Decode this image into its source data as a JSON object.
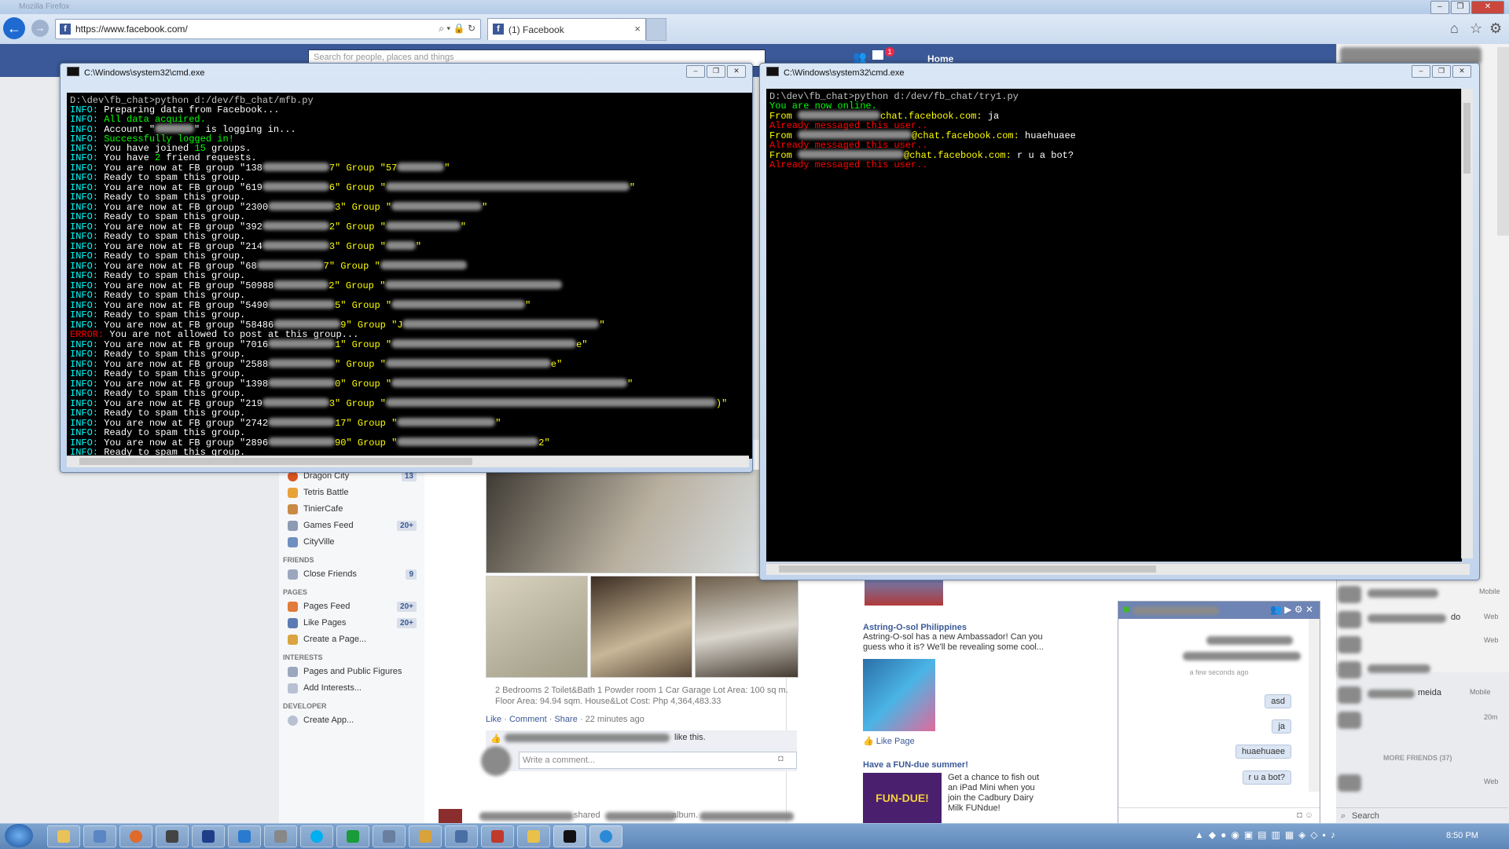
{
  "browser": {
    "url": "https://www.facebook.com/",
    "tab_label": "(1) Facebook",
    "tab_close": "×",
    "faded_title": "Mozilla Firefox"
  },
  "facebook": {
    "search_placeholder": "Search for people, places and things",
    "home_label": "Home",
    "notification_count": "1",
    "sidebar": {
      "apps": [
        {
          "label": "Dragon City",
          "count": "13",
          "color": "#d9531e"
        },
        {
          "label": "Tetris Battle",
          "count": "",
          "color": "#e8a23a"
        },
        {
          "label": "TinierCafe",
          "count": "",
          "color": "#c98a45"
        },
        {
          "label": "Games Feed",
          "count": "20+",
          "color": "#8c9bb3"
        },
        {
          "label": "CityVille",
          "count": "",
          "color": "#6f8fbf"
        }
      ],
      "friends_heading": "FRIENDS",
      "close_friends": {
        "label": "Close Friends",
        "count": "9"
      },
      "pages_heading": "PAGES",
      "pages": [
        {
          "label": "Pages Feed",
          "count": "20+"
        },
        {
          "label": "Like Pages",
          "count": "20+"
        },
        {
          "label": "Create a Page...",
          "count": ""
        }
      ],
      "interests_heading": "INTERESTS",
      "interests": [
        {
          "label": "Pages and Public Figures"
        },
        {
          "label": "Add Interests..."
        }
      ],
      "developer_heading": "DEVELOPER",
      "developer": [
        {
          "label": "Create App..."
        }
      ]
    },
    "post": {
      "caption_line1": "2 Bedrooms 2 Toilet&Bath 1 Powder room 1 Car Garage Lot Area: 100 sq m.",
      "caption_line2": "Floor Area: 94.94 sqm. House&Lot Cost: Php 4,364,483.33",
      "like": "Like",
      "comment": "Comment",
      "share": "Share",
      "time": "22 minutes ago",
      "sep": "·",
      "likes_suffix": "like this.",
      "comment_placeholder": "Write a comment...",
      "shared_text": "shared",
      "album_text": "album."
    },
    "ads": [
      {
        "title": "Astring-O-sol Philippines",
        "desc": "Astring-O-sol has a new Ambassador! Can you guess who it is? We'll be revealing some cool...",
        "cta": "Like Page"
      },
      {
        "title": "Have a FUN-due summer!",
        "desc": "Get a chance to fish out an iPad Mini when you join the Cadbury Dairy Milk FUNdue!",
        "image_text": "FUN-DUE!"
      }
    ],
    "chat": {
      "timestamp": "a few seconds ago",
      "messages": [
        "asd",
        "ja",
        "huaehuaee",
        "r u a bot?"
      ]
    },
    "friends": {
      "more_friends": "MORE FRIENDS (37)",
      "status_labels": [
        "Mobile",
        "Web",
        "Web",
        "Mobile",
        "20m",
        "Web"
      ],
      "partial_names": [
        "do",
        "meida"
      ],
      "search_label": "Search"
    }
  },
  "cmd_left": {
    "title": "C:\\Windows\\system32\\cmd.exe",
    "lines": [
      [
        {
          "t": "D:\\dev\\fb_chat>python d:/dev/fb_chat/mfb.py",
          "c": "gray"
        }
      ],
      [
        {
          "t": "INFO:",
          "c": "c"
        },
        {
          "t": " Preparing data from Facebook...",
          "c": "w"
        }
      ],
      [
        {
          "t": "INFO:",
          "c": "c"
        },
        {
          "t": " All data acquired.",
          "c": "g"
        }
      ],
      [
        {
          "t": "INFO:",
          "c": "c"
        },
        {
          "t": " Account \"",
          "c": "w"
        },
        {
          "b": 50
        },
        {
          "t": "\" is logging in...",
          "c": "w"
        }
      ],
      [
        {
          "t": "INFO:",
          "c": "c"
        },
        {
          "t": " Successfully logged in!",
          "c": "g"
        }
      ],
      [
        {
          "t": "INFO:",
          "c": "c"
        },
        {
          "t": " You have joined ",
          "c": "w"
        },
        {
          "t": "15",
          "c": "g"
        },
        {
          "t": " groups.",
          "c": "w"
        }
      ],
      [
        {
          "t": "INFO:",
          "c": "c"
        },
        {
          "t": " You have ",
          "c": "w"
        },
        {
          "t": "2",
          "c": "g"
        },
        {
          "t": " friend requests.",
          "c": "w"
        }
      ],
      [
        {
          "t": "INFO:",
          "c": "c"
        },
        {
          "t": " You are now at FB group \"138",
          "c": "w"
        },
        {
          "b": 85
        },
        {
          "t": "7\" Group \"57",
          "c": "y"
        },
        {
          "b": 60
        },
        {
          "t": "\"",
          "c": "y"
        }
      ],
      [
        {
          "t": "INFO:",
          "c": "c"
        },
        {
          "t": " Ready to spam this group.",
          "c": "w"
        }
      ],
      [
        {
          "t": "INFO:",
          "c": "c"
        },
        {
          "t": " You are now at FB group \"619",
          "c": "w"
        },
        {
          "b": 85
        },
        {
          "t": "6\" Group \"",
          "c": "y"
        },
        {
          "b": 310
        },
        {
          "t": "\"",
          "c": "y"
        }
      ],
      [
        {
          "t": "INFO:",
          "c": "c"
        },
        {
          "t": " Ready to spam this group.",
          "c": "w"
        }
      ],
      [
        {
          "t": "INFO:",
          "c": "c"
        },
        {
          "t": " You are now at FB group \"2300",
          "c": "w"
        },
        {
          "b": 85
        },
        {
          "t": "3\" Group \"",
          "c": "y"
        },
        {
          "b": 115
        },
        {
          "t": "\"",
          "c": "y"
        }
      ],
      [
        {
          "t": "INFO:",
          "c": "c"
        },
        {
          "t": " Ready to spam this group.",
          "c": "w"
        }
      ],
      [
        {
          "t": "INFO:",
          "c": "c"
        },
        {
          "t": " You are now at FB group \"392",
          "c": "w"
        },
        {
          "b": 85
        },
        {
          "t": "2\" Group \"",
          "c": "y"
        },
        {
          "b": 95
        },
        {
          "t": "\"",
          "c": "y"
        }
      ],
      [
        {
          "t": "INFO:",
          "c": "c"
        },
        {
          "t": " Ready to spam this group.",
          "c": "w"
        }
      ],
      [
        {
          "t": "INFO:",
          "c": "c"
        },
        {
          "t": " You are now at FB group \"214",
          "c": "w"
        },
        {
          "b": 85
        },
        {
          "t": "3\" Group \"",
          "c": "y"
        },
        {
          "b": 38
        },
        {
          "t": "\"",
          "c": "y"
        }
      ],
      [
        {
          "t": "INFO:",
          "c": "c"
        },
        {
          "t": " Ready to spam this group.",
          "c": "w"
        }
      ],
      [
        {
          "t": "INFO:",
          "c": "c"
        },
        {
          "t": " You are now at FB group \"68",
          "c": "w"
        },
        {
          "b": 85
        },
        {
          "t": "7\" Group \"",
          "c": "y"
        },
        {
          "b": 110
        },
        {
          "t": "",
          "c": "y"
        }
      ],
      [
        {
          "t": "INFO:",
          "c": "c"
        },
        {
          "t": " Ready to spam this group.",
          "c": "w"
        }
      ],
      [
        {
          "t": "INFO:",
          "c": "c"
        },
        {
          "t": " You are now at FB group \"50988",
          "c": "w"
        },
        {
          "b": 70
        },
        {
          "t": "2\" Group \"",
          "c": "y"
        },
        {
          "b": 225
        },
        {
          "t": "",
          "c": "y"
        }
      ],
      [
        {
          "t": "INFO:",
          "c": "c"
        },
        {
          "t": " Ready to spam this group.",
          "c": "w"
        }
      ],
      [
        {
          "t": "INFO:",
          "c": "c"
        },
        {
          "t": " You are now at FB group \"5490",
          "c": "w"
        },
        {
          "b": 85
        },
        {
          "t": "5\" Group \"",
          "c": "y"
        },
        {
          "b": 170
        },
        {
          "t": "\"",
          "c": "y"
        }
      ],
      [
        {
          "t": "INFO:",
          "c": "c"
        },
        {
          "t": " Ready to spam this group.",
          "c": "w"
        }
      ],
      [
        {
          "t": "INFO:",
          "c": "c"
        },
        {
          "t": " You are now at FB group \"58486",
          "c": "w"
        },
        {
          "b": 85
        },
        {
          "t": "9\" Group \"J",
          "c": "y"
        },
        {
          "b": 250
        },
        {
          "t": "\"",
          "c": "y"
        }
      ],
      [
        {
          "t": "ERROR:",
          "c": "r"
        },
        {
          "t": " You are not allowed to post at this group...",
          "c": "w"
        }
      ],
      [
        {
          "t": "INFO:",
          "c": "c"
        },
        {
          "t": " You are now at FB group \"7016",
          "c": "w"
        },
        {
          "b": 85
        },
        {
          "t": "1\" Group \"",
          "c": "y"
        },
        {
          "b": 235
        },
        {
          "t": "e\"",
          "c": "y"
        }
      ],
      [
        {
          "t": "INFO:",
          "c": "c"
        },
        {
          "t": " Ready to spam this group.",
          "c": "w"
        }
      ],
      [
        {
          "t": "INFO:",
          "c": "c"
        },
        {
          "t": " You are now at FB group \"2588",
          "c": "w"
        },
        {
          "b": 85
        },
        {
          "t": "\" Group \"",
          "c": "y"
        },
        {
          "b": 210
        },
        {
          "t": "e\"",
          "c": "y"
        }
      ],
      [
        {
          "t": "INFO:",
          "c": "c"
        },
        {
          "t": " Ready to spam this group.",
          "c": "w"
        }
      ],
      [
        {
          "t": "INFO:",
          "c": "c"
        },
        {
          "t": " You are now at FB group \"1398",
          "c": "w"
        },
        {
          "b": 85
        },
        {
          "t": "0\" Group \"",
          "c": "y"
        },
        {
          "b": 300
        },
        {
          "t": "\"",
          "c": "y"
        }
      ],
      [
        {
          "t": "INFO:",
          "c": "c"
        },
        {
          "t": " Ready to spam this group.",
          "c": "w"
        }
      ],
      [
        {
          "t": "INFO:",
          "c": "c"
        },
        {
          "t": " You are now at FB group \"219",
          "c": "w"
        },
        {
          "b": 85
        },
        {
          "t": "3\" Group \"",
          "c": "y"
        },
        {
          "b": 420
        },
        {
          "t": ")\"",
          "c": "y"
        }
      ],
      [
        {
          "t": "INFO:",
          "c": "c"
        },
        {
          "t": " Ready to spam this group.",
          "c": "w"
        }
      ],
      [
        {
          "t": "INFO:",
          "c": "c"
        },
        {
          "t": " You are now at FB group \"2742",
          "c": "w"
        },
        {
          "b": 85
        },
        {
          "t": "17\" Group \"",
          "c": "y"
        },
        {
          "b": 125
        },
        {
          "t": "\"",
          "c": "y"
        }
      ],
      [
        {
          "t": "INFO:",
          "c": "c"
        },
        {
          "t": " Ready to spam this group.",
          "c": "w"
        }
      ],
      [
        {
          "t": "INFO:",
          "c": "c"
        },
        {
          "t": " You are now at FB group \"2896",
          "c": "w"
        },
        {
          "b": 85
        },
        {
          "t": "90\" Group \"",
          "c": "y"
        },
        {
          "b": 180
        },
        {
          "t": "2\"",
          "c": "y"
        }
      ],
      [
        {
          "t": "INFO:",
          "c": "c"
        },
        {
          "t": " Ready to spam this group.",
          "c": "w"
        }
      ]
    ]
  },
  "cmd_right": {
    "title": "C:\\Windows\\system32\\cmd.exe",
    "lines": [
      [
        {
          "t": "D:\\dev\\fb_chat>python d:/dev/fb_chat/try1.py",
          "c": "gray"
        }
      ],
      [
        {
          "t": "You are now online.",
          "c": "g"
        }
      ],
      [
        {
          "t": "From ",
          "c": "y"
        },
        {
          "b": 105
        },
        {
          "t": "chat.facebook.com:",
          "c": "y"
        },
        {
          "t": " ja",
          "c": "w"
        }
      ],
      [
        {
          "t": "Already messaged this user..",
          "c": "r"
        }
      ],
      [
        {
          "t": "From ",
          "c": "y"
        },
        {
          "b": 145
        },
        {
          "t": "@chat.facebook.com:",
          "c": "y"
        },
        {
          "t": " huaehuaee",
          "c": "w"
        }
      ],
      [
        {
          "t": "Already messaged this user..",
          "c": "r"
        }
      ],
      [
        {
          "t": "From ",
          "c": "y"
        },
        {
          "b": 135
        },
        {
          "t": "@chat.facebook.com:",
          "c": "y"
        },
        {
          "t": " r u a bot?",
          "c": "w"
        }
      ],
      [
        {
          "t": "Already messaged this user..",
          "c": "r"
        }
      ]
    ]
  },
  "taskbar": {
    "clock": "8:50 PM"
  }
}
